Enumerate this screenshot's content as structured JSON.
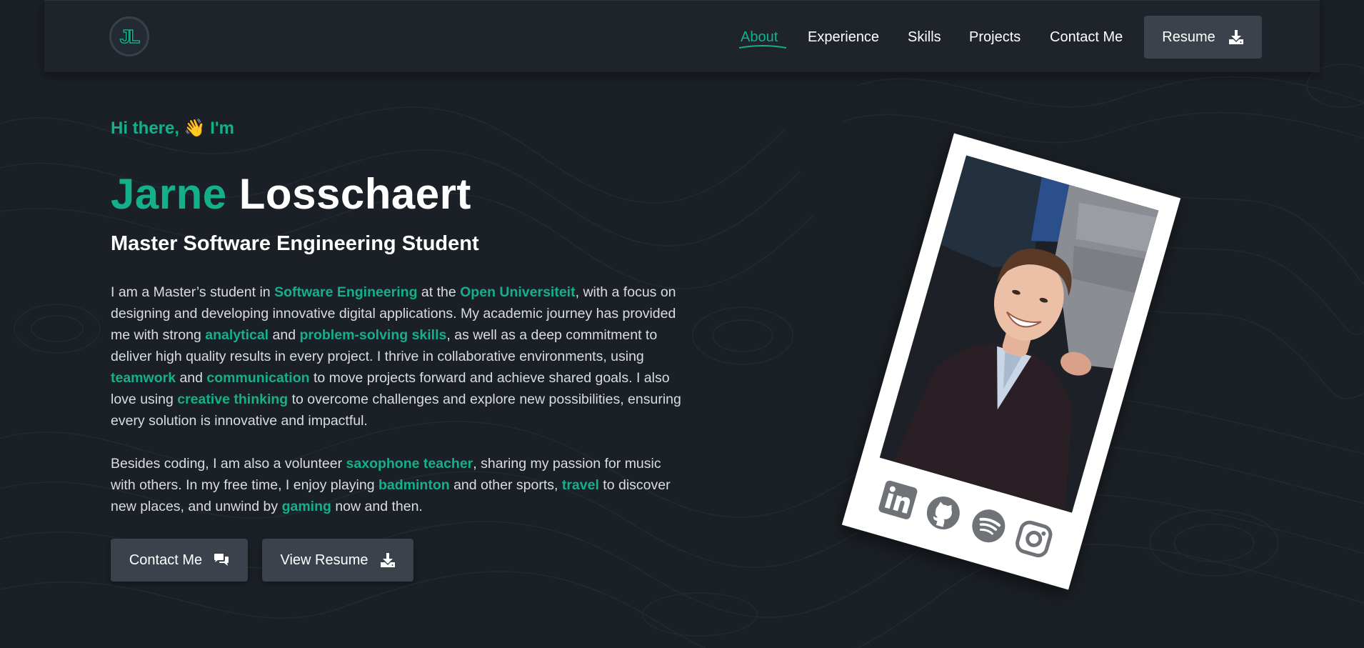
{
  "nav": {
    "logo_text": "JL",
    "links": [
      {
        "label": "About"
      },
      {
        "label": "Experience"
      },
      {
        "label": "Skills"
      },
      {
        "label": "Projects"
      },
      {
        "label": "Contact Me"
      }
    ],
    "resume_label": "Resume"
  },
  "hero": {
    "greeting_pre": "Hi there,",
    "greeting_emoji": "👋",
    "greeting_post": "I'm",
    "first_name": "Jarne",
    "last_name": "Losschaert",
    "subtitle": "Master Software Engineering Student",
    "p1": {
      "t1": "I am a Master’s student in ",
      "h1": "Software Engineering",
      "t2": " at the ",
      "h2": "Open Universiteit",
      "t3": ", with a focus on designing and developing innovative digital applications. My academic journey has provided me with strong ",
      "h3": "analytical",
      "t4": " and ",
      "h4": "problem-solving skills",
      "t5": ", as well as a deep commitment to deliver high quality results in every project. I thrive in collaborative environments, using ",
      "h5": "teamwork",
      "t6": " and ",
      "h6": "communication",
      "t7": " to move projects forward and achieve shared goals. I also love using ",
      "h7": "creative thinking",
      "t8": " to overcome challenges and explore new possibilities, ensuring every solution is innovative and impactful."
    },
    "p2": {
      "t1": "Besides coding, I am also a volunteer ",
      "h1": "saxophone teacher",
      "t2": ", sharing my passion for music with others. In my free time, I enjoy playing ",
      "h2": "badminton",
      "t3": " and other sports, ",
      "h3": "travel",
      "t4": " to discover new places, and unwind by ",
      "h4": "gaming",
      "t5": " now and then."
    },
    "cta_contact": "Contact Me",
    "cta_resume": "View Resume"
  },
  "socials": [
    {
      "icon": "linkedin-icon"
    },
    {
      "icon": "github-icon"
    },
    {
      "icon": "spotify-icon"
    },
    {
      "icon": "instagram-icon"
    }
  ],
  "colors": {
    "accent": "#14b08a",
    "background": "#1b2026",
    "navbar": "#1f242b",
    "button": "#3c424b"
  }
}
